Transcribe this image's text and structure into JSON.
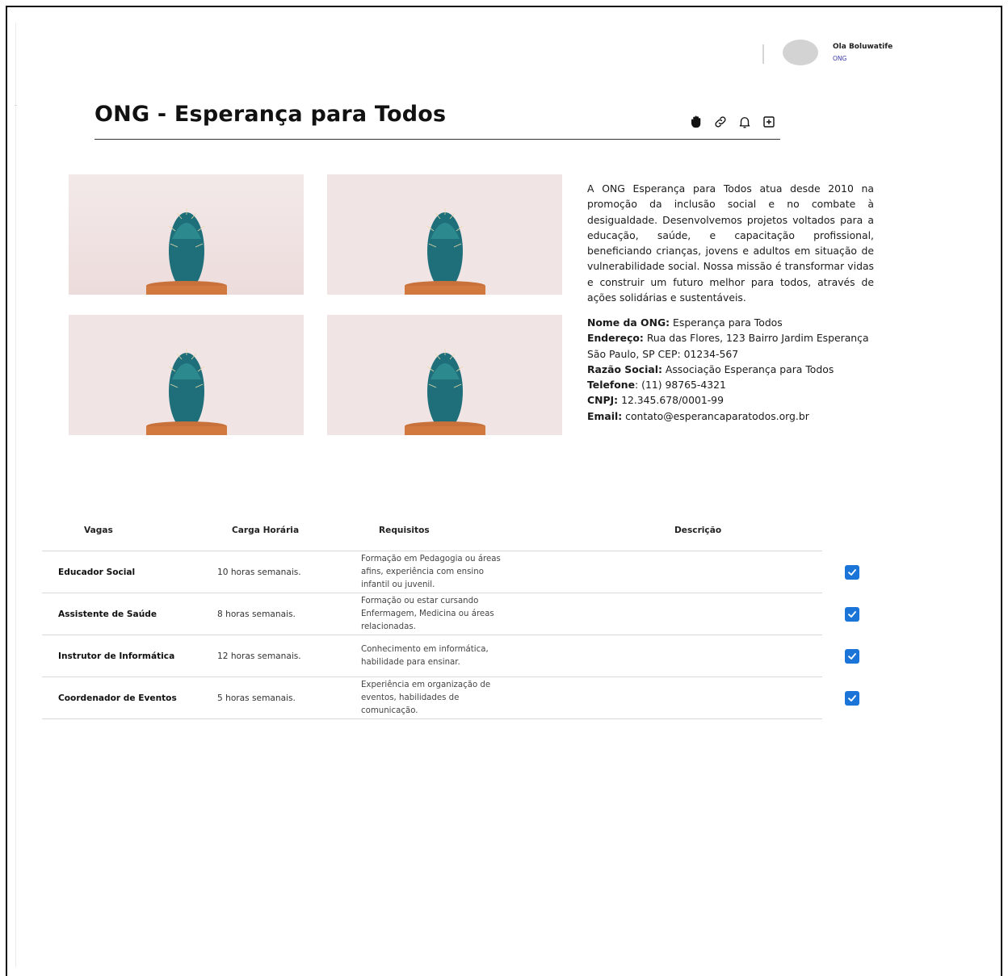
{
  "user": {
    "name": "Ola Boluwatife",
    "role": "ONG"
  },
  "page": {
    "title": "ONG - Esperança para Todos"
  },
  "toolbar": {
    "icons": [
      "hand-icon",
      "link-icon",
      "bell-icon",
      "add-square-icon"
    ]
  },
  "gallery": {
    "image": "cactus-photo",
    "count": 4
  },
  "description": "A ONG Esperança para Todos atua desde 2010 na promoção da inclusão social e no combate à desigualdade. Desenvolvemos projetos voltados para a educação, saúde, e capacitação profissional, beneficiando crianças, jovens e adultos em situação de vulnerabilidade social. Nossa missão é transformar vidas e construir um futuro melhor para todos, através de ações solidárias e sustentáveis.",
  "info": {
    "name_label": "Nome da ONG:",
    "name_value": " Esperança para Todos",
    "address_label": "Endereço:",
    "address_value": " Rua das Flores, 123 Bairro Jardim Esperança",
    "address_line2": "São Paulo, SP CEP: 01234-567",
    "razao_label": "Razão Social:",
    "razao_value": " Associação Esperança para Todos",
    "phone_label": "Telefone",
    "phone_value": ": (11) 98765-4321",
    "cnpj_label": "CNPJ:",
    "cnpj_value": " 12.345.678/0001-99",
    "email_label": "Email:",
    "email_value": " contato@esperancaparatodos.org.br"
  },
  "table": {
    "headers": {
      "vagas": "Vagas",
      "carga": "Carga Horária",
      "requisitos": "Requisitos",
      "descricao": "Descrição"
    },
    "rows": [
      {
        "vaga": "Educador Social",
        "carga": "10 horas semanais.",
        "requisitos": "Formação em Pedagogia ou áreas afins, experiência com ensino infantil ou juvenil.",
        "checked": true
      },
      {
        "vaga": "Assistente de Saúde",
        "carga": "8 horas semanais.",
        "requisitos": "Formação ou estar cursando Enfermagem, Medicina ou áreas relacionadas.",
        "checked": true
      },
      {
        "vaga": "Instrutor de Informática",
        "carga": "12 horas semanais.",
        "requisitos": "Conhecimento em informática, habilidade para ensinar.",
        "checked": true
      },
      {
        "vaga": "Coordenador de Eventos",
        "carga": "5 horas semanais.",
        "requisitos": "Experiência em organização de eventos, habilidades de comunicação.",
        "checked": true
      }
    ]
  },
  "colors": {
    "accent": "#1b74d8",
    "role": "#3a3aa8"
  }
}
